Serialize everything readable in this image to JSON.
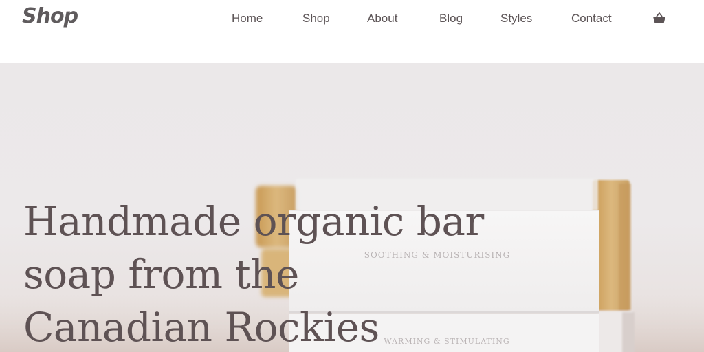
{
  "header": {
    "logo": "Shop",
    "nav": [
      {
        "label": "Home"
      },
      {
        "label": "Shop"
      },
      {
        "label": "About"
      },
      {
        "label": "Blog"
      },
      {
        "label": "Styles"
      },
      {
        "label": "Contact"
      }
    ],
    "cart_icon": "shopping-bag-icon"
  },
  "hero": {
    "title_lines": [
      "Handmade organic bar",
      "soap from the",
      "Canadian Rockies"
    ],
    "soap_label_1": "SOOTHING & MOISTURISING",
    "soap_label_2": "WARMING & STIMULATING"
  },
  "colors": {
    "text": "#5e5254",
    "hero_bg": "#ebe8e9",
    "soap": "#d8b277"
  }
}
